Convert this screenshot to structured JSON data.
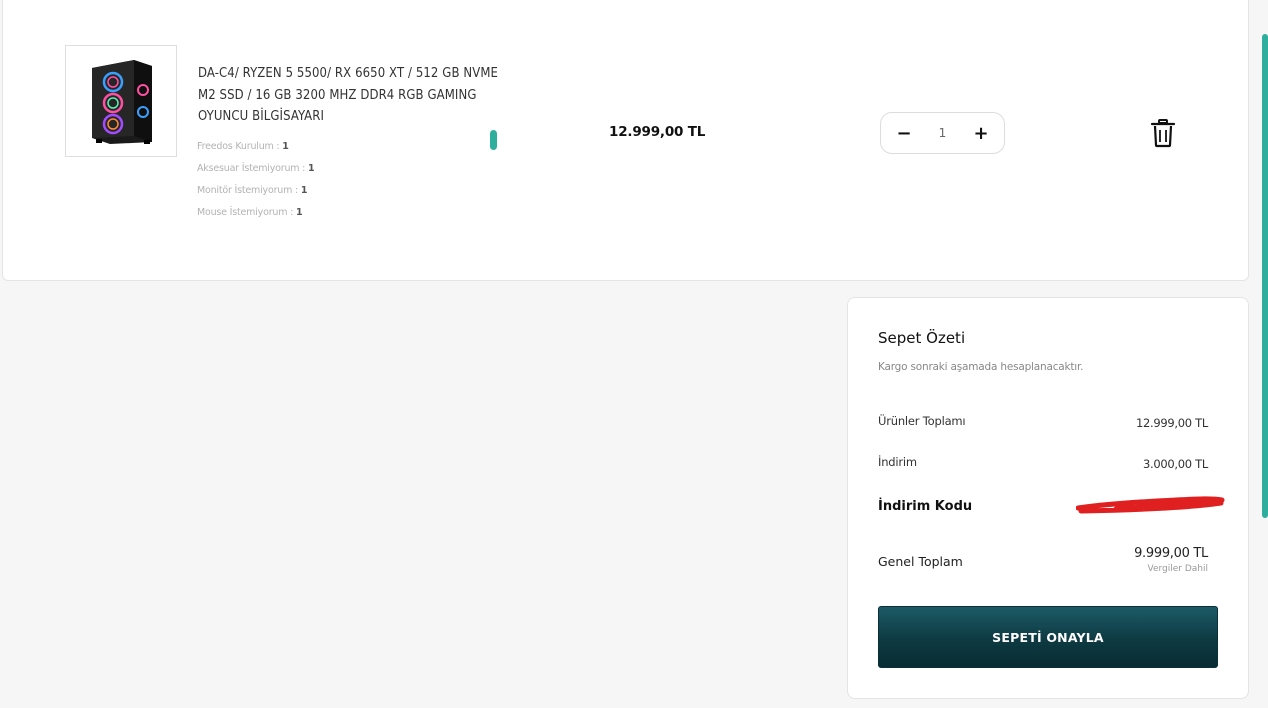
{
  "cart": {
    "item": {
      "title": "DA-C4/ RYZEN 5 5500/ RX 6650 XT / 512 GB NVME M2 SSD / 16 GB 3200 MHZ DDR4 RGB GAMING OYUNCU BİLGİSAYARI",
      "options": [
        {
          "label": "Freedos Kurulum :",
          "value": "1"
        },
        {
          "label": "Aksesuar İstemiyorum :",
          "value": "1"
        },
        {
          "label": "Monitör İstemiyorum :",
          "value": "1"
        },
        {
          "label": "Mouse İstemiyorum :",
          "value": "1"
        }
      ],
      "price": "12.999,00 TL",
      "quantity": "1",
      "decrement_symbol": "−",
      "increment_symbol": "+"
    }
  },
  "summary": {
    "title": "Sepet Özeti",
    "note": "Kargo sonraki aşamada hesaplanacaktır.",
    "products_total_label": "Ürünler Toplamı",
    "products_total_value": "12.999,00 TL",
    "discount_label": "İndirim",
    "discount_value": "3.000,00 TL",
    "discount_code_label": "İndirim Kodu",
    "grand_total_label": "Genel Toplam",
    "grand_total_value": "9.999,00 TL",
    "tax_note": "Vergiler Dahil",
    "confirm_label": "SEPETİ ONAYLA"
  },
  "colors": {
    "accent": "#2fae9e",
    "button_dark": "#0e3a42",
    "redaction": "#e02020"
  }
}
